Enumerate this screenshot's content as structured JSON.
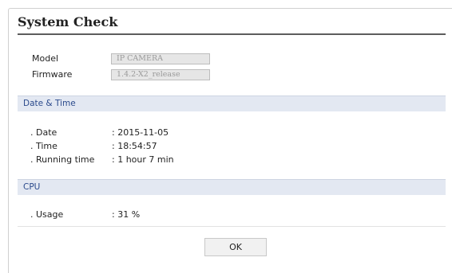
{
  "title": "System Check",
  "info": {
    "model_label": "Model",
    "model_value": "IP CAMERA",
    "firmware_label": "Firmware",
    "firmware_value": "1.4.2-X2_release"
  },
  "date_time": {
    "section_title": "Date & Time",
    "rows": [
      {
        "label": ". Date",
        "value": ": 2015-11-05"
      },
      {
        "label": ". Time",
        "value": ": 18:54:57"
      },
      {
        "label": ". Running time",
        "value": ": 1 hour 7 min"
      }
    ]
  },
  "cpu": {
    "section_title": "CPU",
    "rows": [
      {
        "label": ". Usage",
        "value": ": 31 %"
      }
    ]
  },
  "buttons": {
    "ok_label": "OK"
  }
}
